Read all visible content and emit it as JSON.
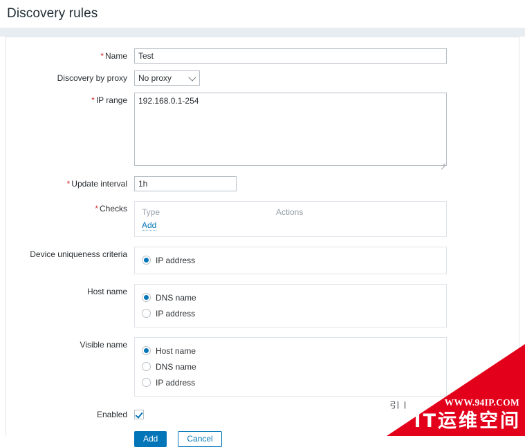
{
  "header": {
    "title": "Discovery rules"
  },
  "form": {
    "rows": [
      {
        "label": "Name",
        "required": true,
        "value": "Test"
      },
      {
        "label": "Discovery by proxy",
        "required": false,
        "value": "No proxy"
      },
      {
        "label": "IP range",
        "required": true,
        "value": "192.168.0.1-254"
      },
      {
        "label": "Update interval",
        "required": true,
        "value": "1h"
      },
      {
        "label": "Checks",
        "required": true
      },
      {
        "label": "Device uniqueness criteria",
        "required": false
      },
      {
        "label": "Host name",
        "required": false
      },
      {
        "label": "Visible name",
        "required": false
      },
      {
        "label": "Enabled",
        "required": false
      }
    ],
    "required_marker": "*",
    "checks": {
      "col_type": "Type",
      "col_actions": "Actions",
      "add_link": "Add"
    },
    "device_uniqueness_criteria": {
      "options": [
        {
          "label": "IP address",
          "checked": true
        }
      ]
    },
    "host_name": {
      "options": [
        {
          "label": "DNS name",
          "checked": true
        },
        {
          "label": "IP address",
          "checked": false
        }
      ]
    },
    "visible_name": {
      "options": [
        {
          "label": "Host name",
          "checked": true
        },
        {
          "label": "DNS name",
          "checked": false
        },
        {
          "label": "IP address",
          "checked": false
        }
      ]
    },
    "enabled": {
      "checked": true
    },
    "buttons": {
      "submit": "Add",
      "cancel": "Cancel"
    }
  },
  "watermark": {
    "url": "WWW.94IP.COM",
    "brand": "IT运维空间",
    "occluded_text": "引丨",
    "color": "#e3001b"
  },
  "colors": {
    "accent": "#0275b8",
    "required": "#d42a2a",
    "band": "#e8edf2",
    "border": "#dfe4e9",
    "input_border": "#b8bfc6",
    "muted_text": "#97a1a8"
  }
}
